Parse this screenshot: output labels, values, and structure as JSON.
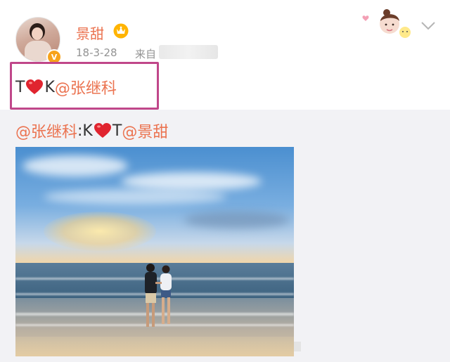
{
  "post": {
    "username": "景甜",
    "verified_badge": "V",
    "time": "18-3-28",
    "source_prefix": "来自",
    "text_before": "T",
    "text_mid": "K",
    "text_mention": "@张继科",
    "icons": [
      "crown-icon",
      "heart-icon",
      "chevron-down-icon"
    ]
  },
  "repost": {
    "mention_author": "@张继科",
    "text_before": ":K",
    "text_after": "T",
    "mention_target": "@景甜"
  },
  "colors": {
    "mention": "#eb7350",
    "highlight_box": "#c0478a",
    "heart": "#e0242f",
    "repost_bg": "#f2f2f5"
  }
}
